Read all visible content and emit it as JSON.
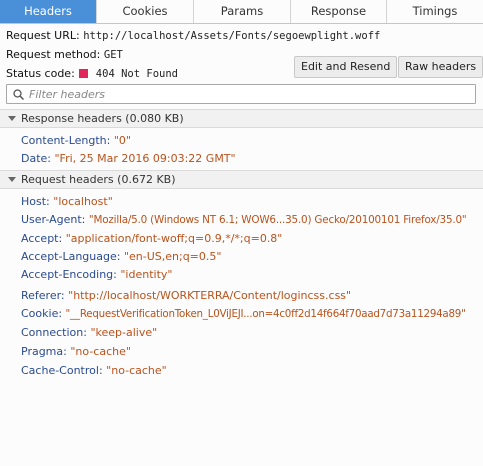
{
  "tabs": [
    {
      "label": "Headers",
      "active": true
    },
    {
      "label": "Cookies",
      "active": false
    },
    {
      "label": "Params",
      "active": false
    },
    {
      "label": "Response",
      "active": false
    },
    {
      "label": "Timings",
      "active": false
    }
  ],
  "summary": {
    "url_label": "Request URL:",
    "url_value": "http://localhost/Assets/Fonts/segoewplight.woff",
    "method_label": "Request method:",
    "method_value": "GET",
    "status_label": "Status code:",
    "status_value": "404 Not Found",
    "status_color": "#e2245d"
  },
  "buttons": {
    "edit_resend": "Edit and Resend",
    "raw_headers": "Raw headers"
  },
  "filter": {
    "placeholder": "Filter headers"
  },
  "response_headers": {
    "title": "Response headers (0.080 KB)",
    "rows": [
      {
        "name": "Content-Length:",
        "value": "\"0\""
      },
      {
        "name": "Date:",
        "value": "\"Fri, 25 Mar 2016 09:03:22 GMT\""
      }
    ]
  },
  "request_headers": {
    "title": "Request headers (0.672 KB)",
    "rows": [
      {
        "name": "Host:",
        "value": "\"localhost\""
      },
      {
        "name": "User-Agent:",
        "value": "\"Mozilla/5.0 (Windows NT 6.1; WOW6...35.0) Gecko/20100101 Firefox/35.0\""
      },
      {
        "name": "Accept:",
        "value": "\"application/font-woff;q=0.9,*/*;q=0.8\""
      },
      {
        "name": "Accept-Language:",
        "value": "\"en-US,en;q=0.5\""
      },
      {
        "name": "Accept-Encoding:",
        "value": "\"identity\""
      },
      {
        "name": "Referer:",
        "value": "\"http://localhost/WORKTERRA/Content/logincss.css\""
      },
      {
        "name": "Cookie:",
        "value": "\"__RequestVerificationToken_L0ViJEJI...on=4c0ff2d14f664f70aad7d73a11294a89\""
      },
      {
        "name": "Connection:",
        "value": "\"keep-alive\""
      },
      {
        "name": "Pragma:",
        "value": "\"no-cache\""
      },
      {
        "name": "Cache-Control:",
        "value": "\"no-cache\""
      }
    ]
  },
  "colors": {
    "active_tab": "#4a90d9",
    "header_name": "#2a4b91",
    "header_value": "#b9521b"
  }
}
